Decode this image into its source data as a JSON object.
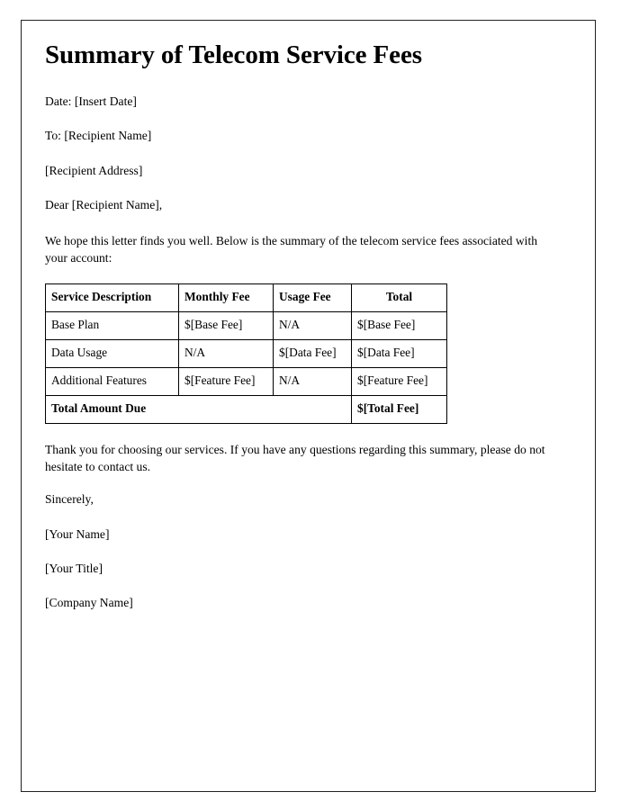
{
  "document": {
    "title": "Summary of Telecom Service Fees",
    "meta": {
      "date_line": "Date: [Insert Date]",
      "to_line": "To: [Recipient Name]",
      "address_line": "[Recipient Address]"
    },
    "salutation": "Dear [Recipient Name],",
    "intro_paragraph": "We hope this letter finds you well. Below is the summary of the telecom service fees associated with your account:",
    "closing_paragraph": "Thank you for choosing our services. If you have any questions regarding this summary, please do not hesitate to contact us.",
    "signoff": "Sincerely,",
    "signature": {
      "name": "[Your Name]",
      "title": "[Your Title]",
      "company": "[Company Name]"
    }
  },
  "fee_table": {
    "headers": [
      "Service Description",
      "Monthly Fee",
      "Usage Fee",
      "Total"
    ],
    "rows": [
      {
        "description": "Base Plan",
        "monthly_fee": "$[Base Fee]",
        "usage_fee": "N/A",
        "total": "$[Base Fee]"
      },
      {
        "description": "Data Usage",
        "monthly_fee": "N/A",
        "usage_fee": "$[Data Fee]",
        "total": "$[Data Fee]"
      },
      {
        "description": "Additional Features",
        "monthly_fee": "$[Feature Fee]",
        "usage_fee": "N/A",
        "total": "$[Feature Fee]"
      }
    ],
    "total_row": {
      "label": "Total Amount Due",
      "total": "$[Total Fee]"
    }
  },
  "colors": {
    "text": "#000000",
    "page_border": "#222222",
    "table_border": "#000000",
    "background": "#ffffff"
  }
}
